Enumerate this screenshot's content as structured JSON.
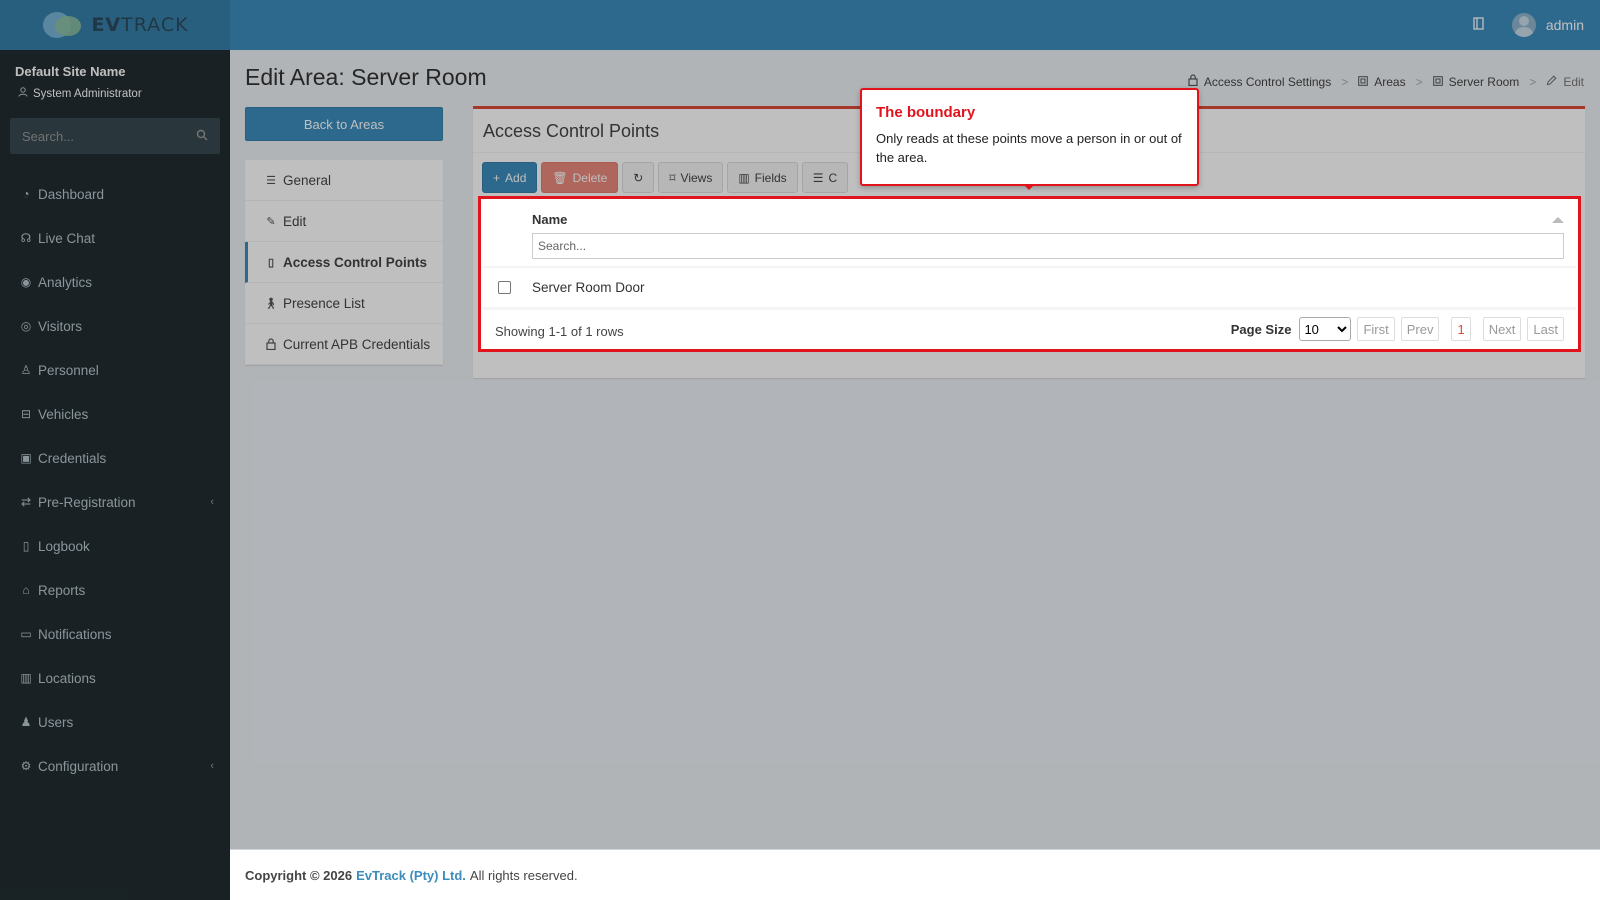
{
  "brand": {
    "logo_bold": "EV",
    "logo_light": "TRACK"
  },
  "sidebar": {
    "site_name": "Default Site Name",
    "user_role": "System Administrator",
    "search_placeholder": "Search...",
    "items": [
      {
        "label": "Dashboard",
        "icon": "dashboard-icon"
      },
      {
        "label": "Live Chat",
        "icon": "headset-icon"
      },
      {
        "label": "Analytics",
        "icon": "analytics-icon"
      },
      {
        "label": "Visitors",
        "icon": "eye-icon"
      },
      {
        "label": "Personnel",
        "icon": "personnel-icon"
      },
      {
        "label": "Vehicles",
        "icon": "vehicle-icon"
      },
      {
        "label": "Credentials",
        "icon": "credentials-icon"
      },
      {
        "label": "Pre-Registration",
        "icon": "arrows-icon",
        "has_submenu": true
      },
      {
        "label": "Logbook",
        "icon": "book-icon"
      },
      {
        "label": "Reports",
        "icon": "reports-icon"
      },
      {
        "label": "Notifications",
        "icon": "chat-icon"
      },
      {
        "label": "Locations",
        "icon": "building-icon"
      },
      {
        "label": "Users",
        "icon": "users-icon"
      },
      {
        "label": "Configuration",
        "icon": "gear-icon",
        "has_submenu": true
      }
    ]
  },
  "header": {
    "username": "admin"
  },
  "page": {
    "title": "Edit Area: Server Room",
    "breadcrumb": [
      "Access Control Settings",
      "Areas",
      "Server Room",
      "Edit"
    ],
    "back_button": "Back to Areas"
  },
  "sub_nav": [
    {
      "label": "General",
      "icon": "list-icon"
    },
    {
      "label": "Edit",
      "icon": "pencil-icon"
    },
    {
      "label": "Access Control Points",
      "icon": "door-icon",
      "active": true
    },
    {
      "label": "Presence List",
      "icon": "walking-icon"
    },
    {
      "label": "Current APB Credentials",
      "icon": "lock-icon"
    }
  ],
  "box": {
    "title": "Access Control Points",
    "toolbar": {
      "add": "Add",
      "delete": "Delete",
      "views": "Views",
      "fields": "Fields",
      "columns": "C"
    },
    "grid": {
      "column": "Name",
      "search_placeholder": "Search...",
      "rows": [
        "Server Room Door"
      ],
      "info": "Showing 1-1 of 1 rows",
      "page_size_label": "Page Size",
      "page_size": "10",
      "pager": {
        "first": "First",
        "prev": "Prev",
        "current": "1",
        "next": "Next",
        "last": "Last"
      }
    }
  },
  "callout": {
    "title": "The boundary",
    "body": "Only reads at these points move a person in or out of the area."
  },
  "footer": {
    "prefix": "Copyright © 2026",
    "company": "EvTrack (Pty) Ltd.",
    "suffix": "All rights reserved."
  },
  "colors": {
    "header": "#3c8dbc",
    "sidebar": "#222d32",
    "accent_red": "#e1141d",
    "box_border": "#dd4b39"
  }
}
